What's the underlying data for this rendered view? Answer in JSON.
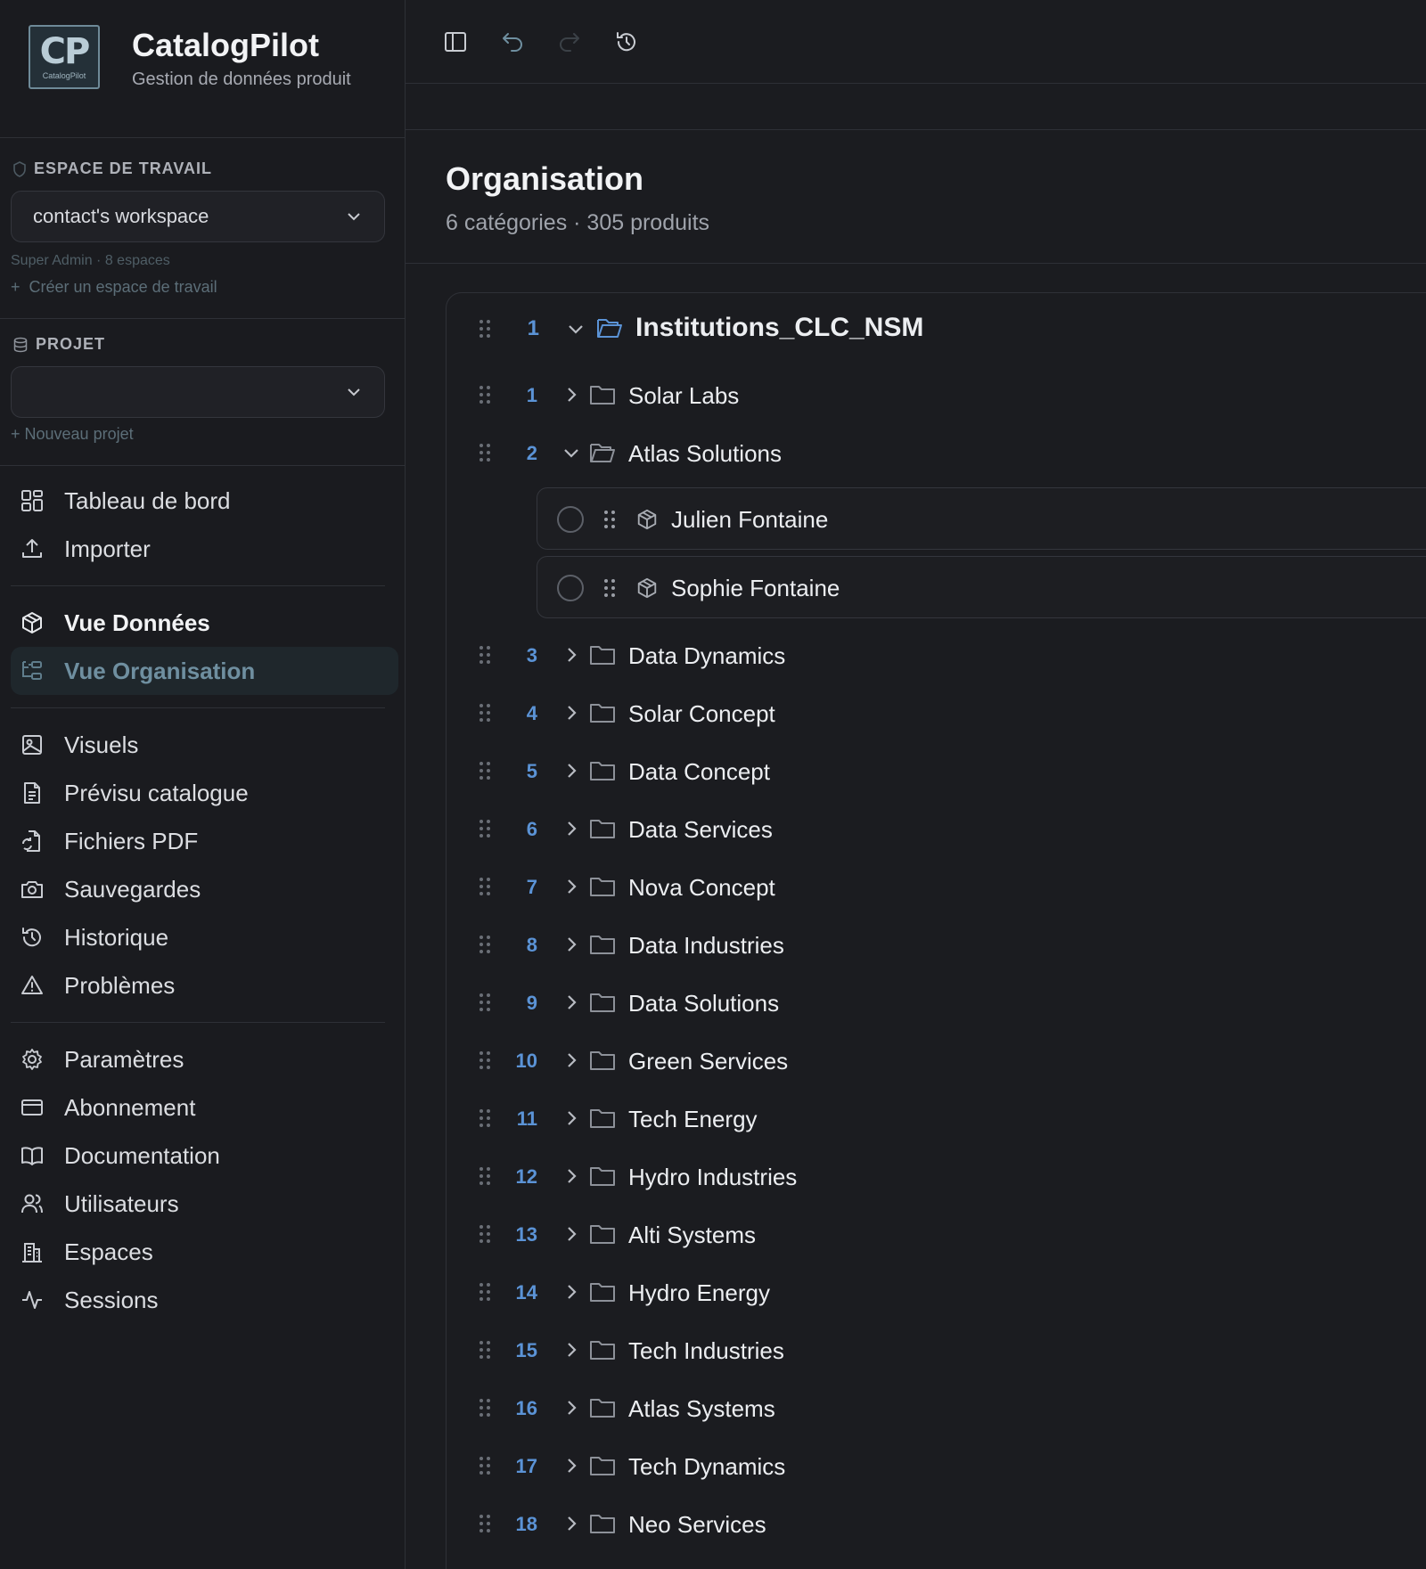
{
  "brand": {
    "logo_text": "CP",
    "logo_subtext": "CatalogPilot",
    "title": "CatalogPilot",
    "subtitle": "Gestion de données produit"
  },
  "workspace": {
    "label": "ESPACE DE TRAVAIL",
    "selected": "contact's workspace",
    "meta": "Super Admin · 8 espaces",
    "create_link": "Créer un espace de travail"
  },
  "project": {
    "label": "PROJET",
    "selected": "",
    "new_link": "+ Nouveau projet"
  },
  "nav": {
    "group1": [
      {
        "label": "Tableau de bord",
        "icon": "dashboard-icon"
      },
      {
        "label": "Importer",
        "icon": "upload-icon"
      }
    ],
    "group2": [
      {
        "label": "Vue Données",
        "icon": "cube-icon"
      },
      {
        "label": "Vue Organisation",
        "icon": "tree-icon",
        "active": true
      }
    ],
    "group3": [
      {
        "label": "Visuels",
        "icon": "image-icon"
      },
      {
        "label": "Prévisu catalogue",
        "icon": "document-icon"
      },
      {
        "label": "Fichiers PDF",
        "icon": "file-refresh-icon"
      },
      {
        "label": "Sauvegardes",
        "icon": "camera-icon"
      },
      {
        "label": "Historique",
        "icon": "history-icon"
      },
      {
        "label": "Problèmes",
        "icon": "warning-icon"
      }
    ],
    "group4": [
      {
        "label": "Paramètres",
        "icon": "gear-icon"
      },
      {
        "label": "Abonnement",
        "icon": "credit-card-icon"
      },
      {
        "label": "Documentation",
        "icon": "book-icon"
      },
      {
        "label": "Utilisateurs",
        "icon": "users-icon"
      },
      {
        "label": "Espaces",
        "icon": "building-icon"
      },
      {
        "label": "Sessions",
        "icon": "activity-icon"
      }
    ]
  },
  "toolbar": {
    "icons": [
      "sidebar-toggle-icon",
      "undo-icon",
      "redo-icon",
      "history-icon"
    ]
  },
  "page": {
    "title": "Organisation",
    "subtitle": "6 catégories · 305 produits"
  },
  "tree": {
    "root": {
      "num": "1",
      "label": "Institutions_CLC_NSM",
      "expanded": true
    },
    "expanded_child": {
      "num": "2",
      "label": "Atlas Solutions",
      "products": [
        "Julien Fontaine",
        "Sophie Fontaine"
      ]
    },
    "children": [
      {
        "num": "1",
        "label": "Solar Labs"
      },
      {
        "num": "2",
        "label": "Atlas Solutions",
        "expanded": true
      },
      {
        "num": "3",
        "label": "Data Dynamics"
      },
      {
        "num": "4",
        "label": "Solar Concept"
      },
      {
        "num": "5",
        "label": "Data Concept"
      },
      {
        "num": "6",
        "label": "Data Services"
      },
      {
        "num": "7",
        "label": "Nova Concept"
      },
      {
        "num": "8",
        "label": "Data Industries"
      },
      {
        "num": "9",
        "label": "Data Solutions"
      },
      {
        "num": "10",
        "label": "Green Services"
      },
      {
        "num": "11",
        "label": "Tech Energy"
      },
      {
        "num": "12",
        "label": "Hydro Industries"
      },
      {
        "num": "13",
        "label": "Alti Systems"
      },
      {
        "num": "14",
        "label": "Hydro Energy"
      },
      {
        "num": "15",
        "label": "Tech Industries"
      },
      {
        "num": "16",
        "label": "Atlas Systems"
      },
      {
        "num": "17",
        "label": "Tech Dynamics"
      },
      {
        "num": "18",
        "label": "Neo Services"
      }
    ]
  },
  "colors": {
    "accent_number": "#5b93d6",
    "active_nav_text": "#6f8fa0",
    "background": "#1b1c20"
  }
}
